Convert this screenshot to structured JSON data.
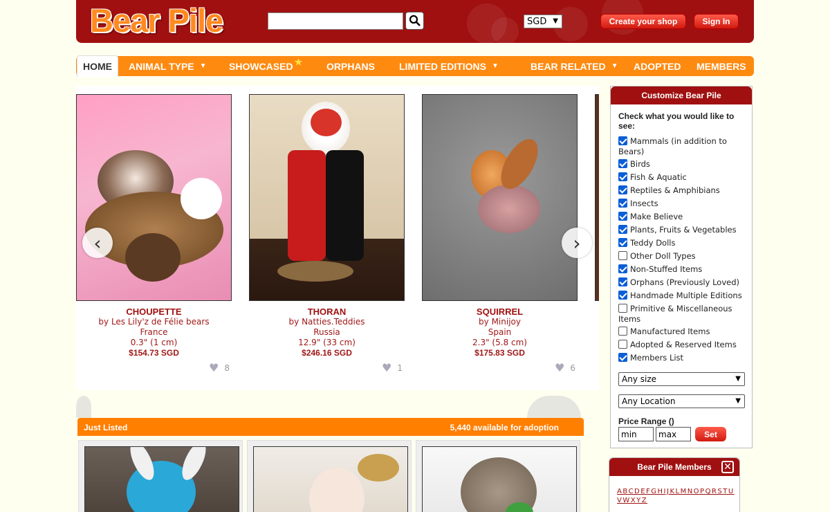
{
  "header": {
    "logo": "Bear Pile",
    "search_placeholder": "",
    "currency": "SGD",
    "create_shop": "Create your shop",
    "sign_in": "Sign In"
  },
  "nav": {
    "home": "HOME",
    "animal_type": "ANIMAL TYPE",
    "showcased": "SHOWCASED",
    "orphans": "ORPHANS",
    "limited_editions": "LIMITED EDITIONS",
    "bear_related": "BEAR RELATED",
    "adopted": "ADOPTED",
    "members": "MEMBERS"
  },
  "carousel": {
    "items": [
      {
        "name": "CHOUPETTE",
        "artist": "by Les Lily'z de Félie bears",
        "country": "France",
        "size": "0.3\" (1 cm)",
        "price": "$154.73 SGD",
        "likes": "8"
      },
      {
        "name": "THORAN",
        "artist": "by Natties.Teddies",
        "country": "Russia",
        "size": "12.9\" (33 cm)",
        "price": "$246.16 SGD",
        "likes": "1"
      },
      {
        "name": "SQUIRREL",
        "artist": "by Minijoy",
        "country": "Spain",
        "size": "2.3\" (5.8 cm)",
        "price": "$175.83 SGD",
        "likes": "6"
      }
    ]
  },
  "just_listed": {
    "title": "Just Listed",
    "count": "5,440 available for adoption"
  },
  "customize": {
    "title": "Customize Bear Pile",
    "prompt": "Check what you would like to see:",
    "options": [
      {
        "label": "Mammals (in addition to Bears)",
        "checked": true
      },
      {
        "label": "Birds",
        "checked": true
      },
      {
        "label": "Fish & Aquatic",
        "checked": true
      },
      {
        "label": "Reptiles & Amphibians",
        "checked": true
      },
      {
        "label": "Insects",
        "checked": true
      },
      {
        "label": "Make Believe",
        "checked": true
      },
      {
        "label": "Plants, Fruits & Vegetables",
        "checked": true
      },
      {
        "label": "Teddy Dolls",
        "checked": true
      },
      {
        "label": "Other Doll Types",
        "checked": false
      },
      {
        "label": "Non-Stuffed Items",
        "checked": true
      },
      {
        "label": "Orphans (Previously Loved)",
        "checked": true
      },
      {
        "label": "Handmade Multiple Editions",
        "checked": true
      },
      {
        "label": "Primitive & Miscellaneous Items",
        "checked": false
      },
      {
        "label": "Manufactured Items",
        "checked": false
      },
      {
        "label": "Adopted & Reserved Items",
        "checked": false
      },
      {
        "label": "Members List",
        "checked": true
      }
    ],
    "size_select": "Any size",
    "location_select": "Any Location",
    "price_range_label": "Price Range ()",
    "min_placeholder": "min",
    "max_placeholder": "max",
    "set_button": "Set"
  },
  "members": {
    "title": "Bear Pile Members",
    "close": "✕",
    "letters": "ABCDEFGHIJKLMNOPQRSTUVWXYZ"
  },
  "colors": {
    "brand_red": "#a01010",
    "nav_orange": "#ff8a10",
    "page_bg": "#fffff0"
  }
}
